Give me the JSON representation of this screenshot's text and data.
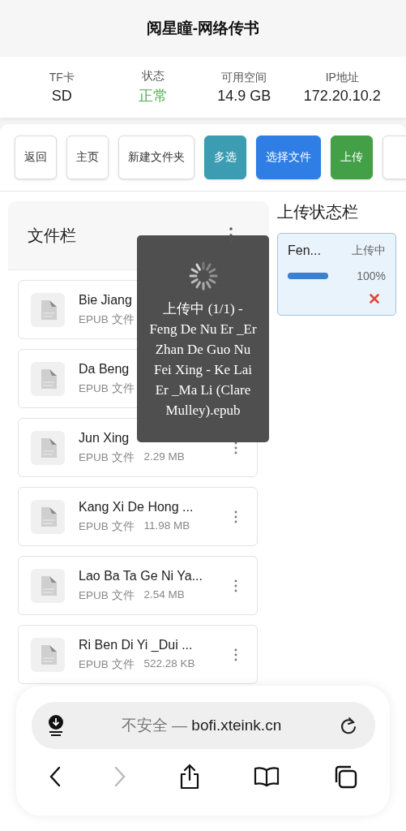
{
  "title": "阅星瞳-网络传书",
  "info": [
    {
      "label": "TF卡",
      "value": "SD",
      "kind": "plain"
    },
    {
      "label": "状态",
      "value": "正常",
      "kind": "ok"
    },
    {
      "label": "可用空间",
      "value": "14.9 GB",
      "kind": "plain"
    },
    {
      "label": "IP地址",
      "value": "172.20.10.2",
      "kind": "plain"
    }
  ],
  "toolbar": [
    {
      "label": "返回",
      "kind": "plain"
    },
    {
      "label": "主页",
      "kind": "plain"
    },
    {
      "label": "新建文件夹",
      "kind": "plain"
    },
    {
      "label": "多选",
      "kind": "teal"
    },
    {
      "label": "选择文件",
      "kind": "blue"
    },
    {
      "label": "上传",
      "kind": "green"
    },
    {
      "kind": "cut"
    }
  ],
  "files_panel": {
    "title": "文件栏",
    "files": [
      {
        "name": "Bie Jiang",
        "type": "EPUB 文件",
        "menu": false
      },
      {
        "name": "Da Beng",
        "type": "EPUB 文件",
        "menu": false
      },
      {
        "name": "Jun Xing",
        "type": "EPUB 文件",
        "size": "2.29 MB",
        "menu": true
      },
      {
        "name": "Kang Xi De Hong ...",
        "type": "EPUB 文件",
        "size": "11.98 MB",
        "menu": true
      },
      {
        "name": "Lao Ba Ta Ge Ni Ya...",
        "type": "EPUB 文件",
        "size": "2.54 MB",
        "menu": true
      },
      {
        "name": "Ri Ben Di Yi _Dui ...",
        "type": "EPUB 文件",
        "size": "522.28 KB",
        "menu": true
      }
    ]
  },
  "upload_panel": {
    "title": "上传状态栏",
    "uploads": [
      {
        "name": "Fen...",
        "status": "上传中",
        "level": 1,
        "percent": "100%"
      }
    ]
  },
  "overlay": {
    "message_lines": [
      "上传中 (1/1) -",
      "Feng De Nu Er _Er",
      "Zhan De Guo Nu",
      "Fei Xing - Ke Lai",
      "Er _Ma Li (Clare",
      "Mulley).epub"
    ]
  },
  "browser": {
    "security": "不安全 —",
    "domain": "bofi.xteink.cn"
  }
}
